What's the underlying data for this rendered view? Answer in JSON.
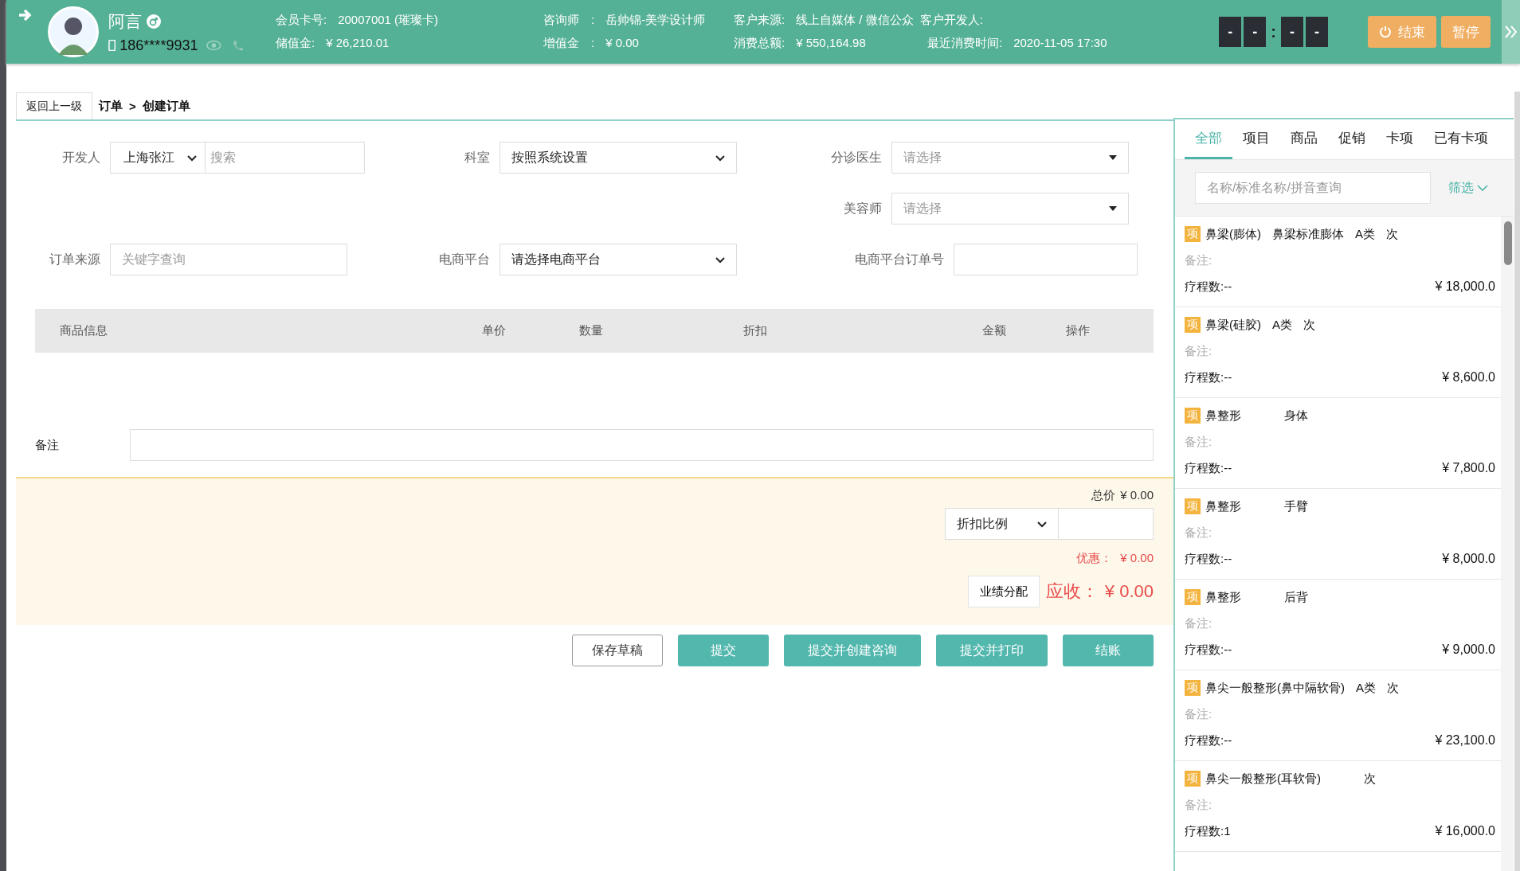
{
  "header": {
    "customer_name": "阿言",
    "phone": "186****9931",
    "info_rows": [
      [
        {
          "label": "会员卡号:",
          "value": "20007001 (璀璨卡)"
        },
        {
          "label": "咨询师　:",
          "value": "岳帅锦-美学设计师"
        },
        {
          "label": "客户来源:",
          "value": "线上自媒体 / 微信公众"
        },
        {
          "label": "客户开发人:"
        }
      ],
      [
        {
          "label": "储值金:",
          "value": "¥ 26,210.01"
        },
        {
          "label": "增值金　:",
          "value": "¥ 0.00"
        },
        {
          "label": "消费总额:",
          "value": "¥ 550,164.98"
        },
        {
          "label": "最近消费时间:",
          "value": "2020-11-05 17:30"
        }
      ]
    ],
    "timer": {
      "digits": [
        "-",
        "-",
        "-",
        "-"
      ],
      "separator": ":"
    },
    "buttons": [
      "结束",
      "暂停"
    ]
  },
  "breadcrumb": {
    "back": "返回上一级",
    "items": [
      "订单",
      "创建订单"
    ],
    "separator": ">"
  },
  "form": {
    "rows": [
      [
        {
          "label": "开发人",
          "kind": "select-search",
          "value": "上海张江",
          "placeholder": "搜索"
        },
        {
          "label": "科室",
          "kind": "select",
          "value": "按照系统设置"
        },
        {
          "label": "分诊医生",
          "kind": "dropdown",
          "placeholder": "请选择"
        }
      ],
      [
        {
          "kind": "empty"
        },
        {
          "kind": "empty"
        },
        {
          "label": "美容师",
          "kind": "dropdown",
          "placeholder": "请选择"
        }
      ],
      [
        {
          "label": "订单来源",
          "kind": "input",
          "placeholder": "关键字查询"
        },
        {
          "label": "电商平台",
          "kind": "select",
          "value": "请选择电商平台"
        },
        {
          "label": "电商平台订单号",
          "kind": "input"
        }
      ]
    ]
  },
  "table": {
    "columns": [
      "商品信息",
      "单价",
      "数量",
      "折扣",
      "金额",
      "操作"
    ]
  },
  "remark": {
    "label": "备注"
  },
  "summary": {
    "total_label": "总价",
    "total": "¥ 0.00",
    "discount_select": "折扣比例",
    "discount_label": "优惠：",
    "discount": "¥ 0.00",
    "allocate": "业绩分配",
    "due_label": "应收：",
    "due": "¥ 0.00"
  },
  "actions": [
    {
      "label": "保存草稿",
      "kind": "outline"
    },
    {
      "label": "提交",
      "kind": "primary"
    },
    {
      "label": "提交并创建咨询",
      "kind": "primary"
    },
    {
      "label": "提交并打印",
      "kind": "primary"
    },
    {
      "label": "结账",
      "kind": "primary"
    }
  ],
  "catalog": {
    "tabs": [
      {
        "label": "全部",
        "selected": true
      },
      {
        "label": "项目",
        "selected": false
      },
      {
        "label": "商品",
        "selected": false
      },
      {
        "label": "促销",
        "selected": false
      },
      {
        "label": "卡项",
        "selected": false
      },
      {
        "label": "已有卡项",
        "selected": false
      }
    ],
    "search": {
      "placeholder": "名称/标准名称/拼音查询"
    },
    "filter": "筛选",
    "items": [
      {
        "tag": "项",
        "parts": [
          "鼻梁(膨体)",
          "鼻梁标准膨体",
          "A类",
          "次"
        ],
        "remark": "备注:",
        "sessions": "疗程数:--",
        "price": "¥ 18,000.0"
      },
      {
        "tag": "项",
        "parts": [
          "鼻梁(硅胶)",
          "A类",
          "次"
        ],
        "remark": "备注:",
        "sessions": "疗程数:--",
        "price": "¥ 8,600.0"
      },
      {
        "tag": "项",
        "parts": [
          "鼻整形",
          "身体"
        ],
        "remark": "备注:",
        "sessions": "疗程数:--",
        "price": "¥ 7,800.0"
      },
      {
        "tag": "项",
        "parts": [
          "鼻整形",
          "手臂"
        ],
        "remark": "备注:",
        "sessions": "疗程数:--",
        "price": "¥ 8,000.0"
      },
      {
        "tag": "项",
        "parts": [
          "鼻整形",
          "后背"
        ],
        "remark": "备注:",
        "sessions": "疗程数:--",
        "price": "¥ 9,000.0"
      },
      {
        "tag": "项",
        "parts": [
          "鼻尖一般整形(鼻中隔软骨)",
          "A类",
          "次"
        ],
        "remark": "备注:",
        "sessions": "疗程数:--",
        "price": "¥ 23,100.0"
      },
      {
        "tag": "项",
        "parts": [
          "鼻尖一般整形(耳软骨)",
          "次"
        ],
        "remark": "备注:",
        "sessions": "疗程数:1",
        "price": "¥ 16,000.0"
      }
    ]
  }
}
